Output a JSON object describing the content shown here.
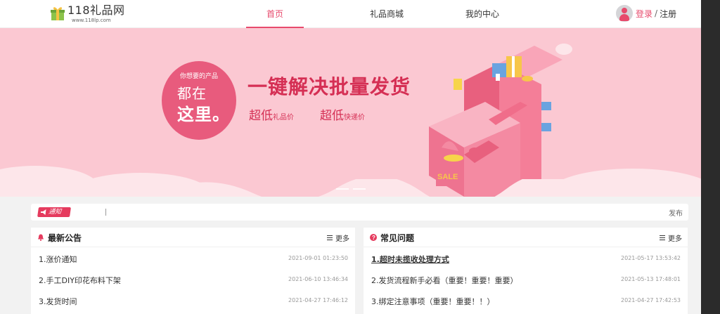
{
  "header": {
    "logo_title": "118礼品网",
    "logo_url": "www.118lp.com",
    "nav": [
      {
        "label": "首页",
        "active": true
      },
      {
        "label": "礼品商城",
        "active": false
      },
      {
        "label": "我的中心",
        "active": false
      }
    ],
    "login_label": "登录",
    "separator": "/",
    "register_label": "注册"
  },
  "banner": {
    "bubble_sub": "你想要的产品",
    "bubble_line1": "都在",
    "bubble_line2": "这里。",
    "headline": "一键解决批量发货",
    "price1_big": "超低",
    "price1_small": "礼品价",
    "price2_big": "超低",
    "price2_small": "快递价",
    "illustration_text": "SALE"
  },
  "notice": {
    "tag": "通知",
    "right_text": "发布"
  },
  "announcements": {
    "title": "最新公告",
    "more": "更多",
    "items": [
      {
        "text": "1.涨价通知",
        "date": "2021-09-01 01:23:50"
      },
      {
        "text": "2.手工DIY印花布料下架",
        "date": "2021-06-10 13:46:34"
      },
      {
        "text": "3.发货时间",
        "date": "2021-04-27 17:46:12"
      }
    ]
  },
  "faq": {
    "title": "常见问题",
    "more": "更多",
    "items": [
      {
        "text": "1.超时未揽收处理方式",
        "date": "2021-05-17 13:53:42"
      },
      {
        "text": "2.发货流程新手必看（重要！重要！重要）",
        "date": "2021-05-13 17:48:01"
      },
      {
        "text": "3.绑定注意事项（重要！重要！！）",
        "date": "2021-04-27 17:42:53"
      }
    ]
  },
  "colors": {
    "accent": "#e74a6c",
    "banner_bg": "#fbc8d2",
    "headline": "#d52f54"
  }
}
